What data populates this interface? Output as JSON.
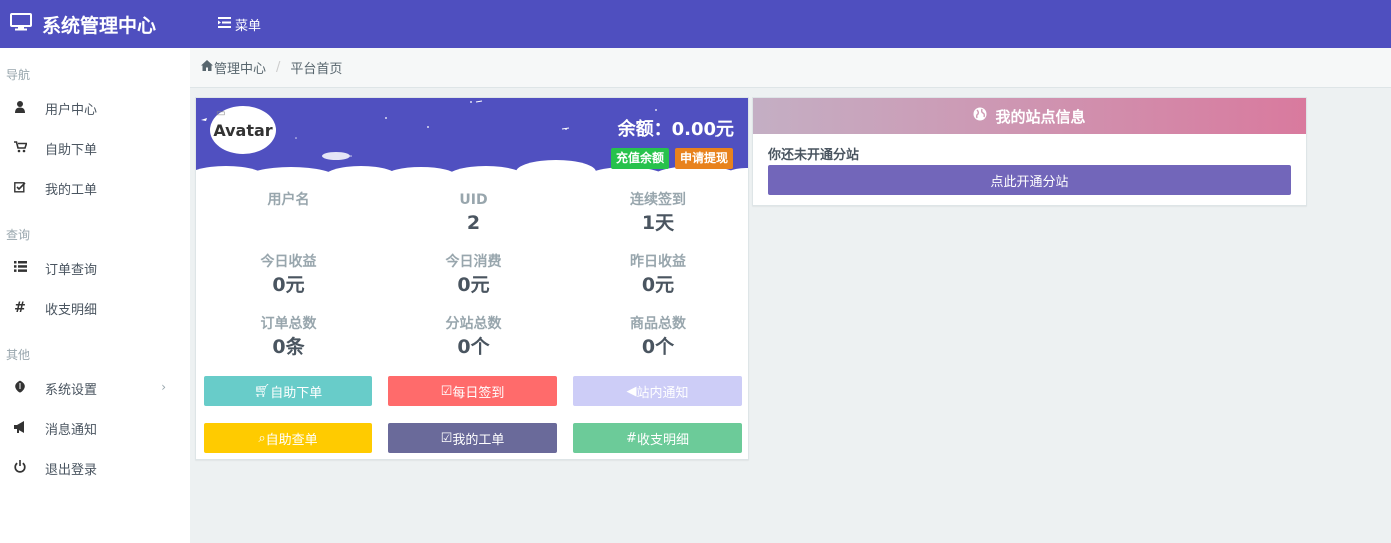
{
  "app": {
    "title": "系统管理中心",
    "menu_label": "菜单"
  },
  "sidebar": {
    "sections": [
      {
        "header": "导航",
        "items": [
          {
            "label": "用户中心",
            "icon": "user-icon"
          },
          {
            "label": "自助下单",
            "icon": "cart-icon"
          },
          {
            "label": "我的工单",
            "icon": "check-square-icon"
          }
        ]
      },
      {
        "header": "查询",
        "items": [
          {
            "label": "订单查询",
            "icon": "list-icon"
          },
          {
            "label": "收支明细",
            "icon": "hash-icon"
          }
        ]
      },
      {
        "header": "其他",
        "items": [
          {
            "label": "系统设置",
            "icon": "rebel-icon"
          },
          {
            "label": "消息通知",
            "icon": "bullhorn-icon"
          },
          {
            "label": "退出登录",
            "icon": "power-icon"
          }
        ]
      }
    ]
  },
  "breadcrumb": {
    "home": "管理中心",
    "sep": "/",
    "current": "平台首页"
  },
  "user_card": {
    "avatar_alt": "Avatar",
    "balance": "余额：0.00元",
    "recharge_label": "充值余额",
    "withdraw_label": "申请提现",
    "stats": [
      {
        "key": "用户名",
        "value": ""
      },
      {
        "key": "UID",
        "value": "2"
      },
      {
        "key": "连续签到",
        "value": "1天"
      },
      {
        "key": "今日收益",
        "value": "0元"
      },
      {
        "key": "今日消费",
        "value": "0元"
      },
      {
        "key": "昨日收益",
        "value": "0元"
      },
      {
        "key": "订单总数",
        "value": "0条"
      },
      {
        "key": "分站总数",
        "value": "0个"
      },
      {
        "key": "商品总数",
        "value": "0个"
      }
    ],
    "buttons": [
      {
        "label": "自助下单",
        "color": "#68ccc9",
        "icon": "cart-icon"
      },
      {
        "label": "每日签到",
        "color": "#ff6b6b",
        "icon": "check-square-icon"
      },
      {
        "label": "站内通知",
        "color": "#cdcdf7",
        "icon": "bullhorn-icon"
      },
      {
        "label": "自助查单",
        "color": "#ffcb00",
        "icon": "search-icon"
      },
      {
        "label": "我的工单",
        "color": "#6a6a9a",
        "icon": "check-square-icon"
      },
      {
        "label": "收支明细",
        "color": "#6ccb99",
        "icon": "hash-icon"
      }
    ]
  },
  "site_card": {
    "title": "我的站点信息",
    "message": "你还未开通分站",
    "button_label": "点此开通分站"
  }
}
